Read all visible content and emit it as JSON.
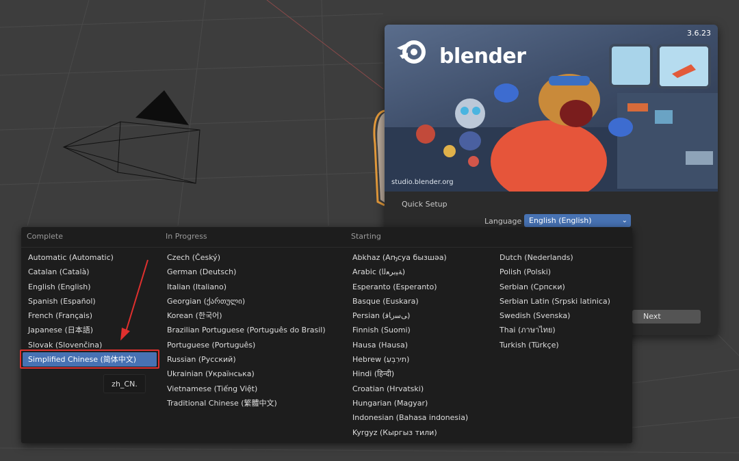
{
  "splash": {
    "version": "3.6.23",
    "brand": "blender",
    "studio_url": "studio.blender.org",
    "quick_setup_title": "Quick Setup",
    "language_label": "Language",
    "language_value": "English (English)",
    "next_label": "Next"
  },
  "language_menu": {
    "columns": [
      {
        "header": "Complete",
        "items": [
          "Automatic (Automatic)",
          "Catalan (Català)",
          "English (English)",
          "Spanish (Español)",
          "French (Français)",
          "Japanese (日本語)",
          "Slovak (Slovenčina)",
          "Simplified Chinese (简体中文)"
        ]
      },
      {
        "header": "In Progress",
        "items": [
          "Czech (Český)",
          "German (Deutsch)",
          "Italian (Italiano)",
          "Georgian (ქართული)",
          "Korean (한국어)",
          "Brazilian Portuguese (Português do Brasil)",
          "Portuguese (Português)",
          "Russian (Русский)",
          "Ukrainian (Українська)",
          "Vietnamese (Tiếng Việt)",
          "Traditional Chinese (繁體中文)"
        ]
      },
      {
        "header": "Starting",
        "items": [
          "Abkhaz (Аҧсуа бызшәа)",
          "Arabic (ﺔﻴﺑﺮﻌﻟﺍ)",
          "Esperanto (Esperanto)",
          "Basque (Euskara)",
          "Persian (ﯽﺳﺭﺎﻓ)",
          "Finnish (Suomi)",
          "Hausa (Hausa)",
          "Hebrew (תירִבְעִ)",
          "Hindi (हिन्दी)",
          "Croatian (Hrvatski)",
          "Hungarian (Magyar)",
          "Indonesian (Bahasa indonesia)",
          "Kyrgyz (Кыргыз тили)"
        ]
      },
      {
        "header": "",
        "items": [
          "Dutch (Nederlands)",
          "Polish (Polski)",
          "Serbian (Српски)",
          "Serbian Latin (Srpski latinica)",
          "Swedish (Svenska)",
          "Thai (ภาษาไทย)",
          "Turkish (Türkçe)"
        ]
      }
    ],
    "selected_item": "Simplified Chinese (简体中文)",
    "tooltip": "zh_CN."
  },
  "colors": {
    "accent": "#4772b3",
    "annotation": "#e0302e",
    "menu_bg": "#1d1d1d",
    "viewport_bg": "#3d3d3d"
  }
}
